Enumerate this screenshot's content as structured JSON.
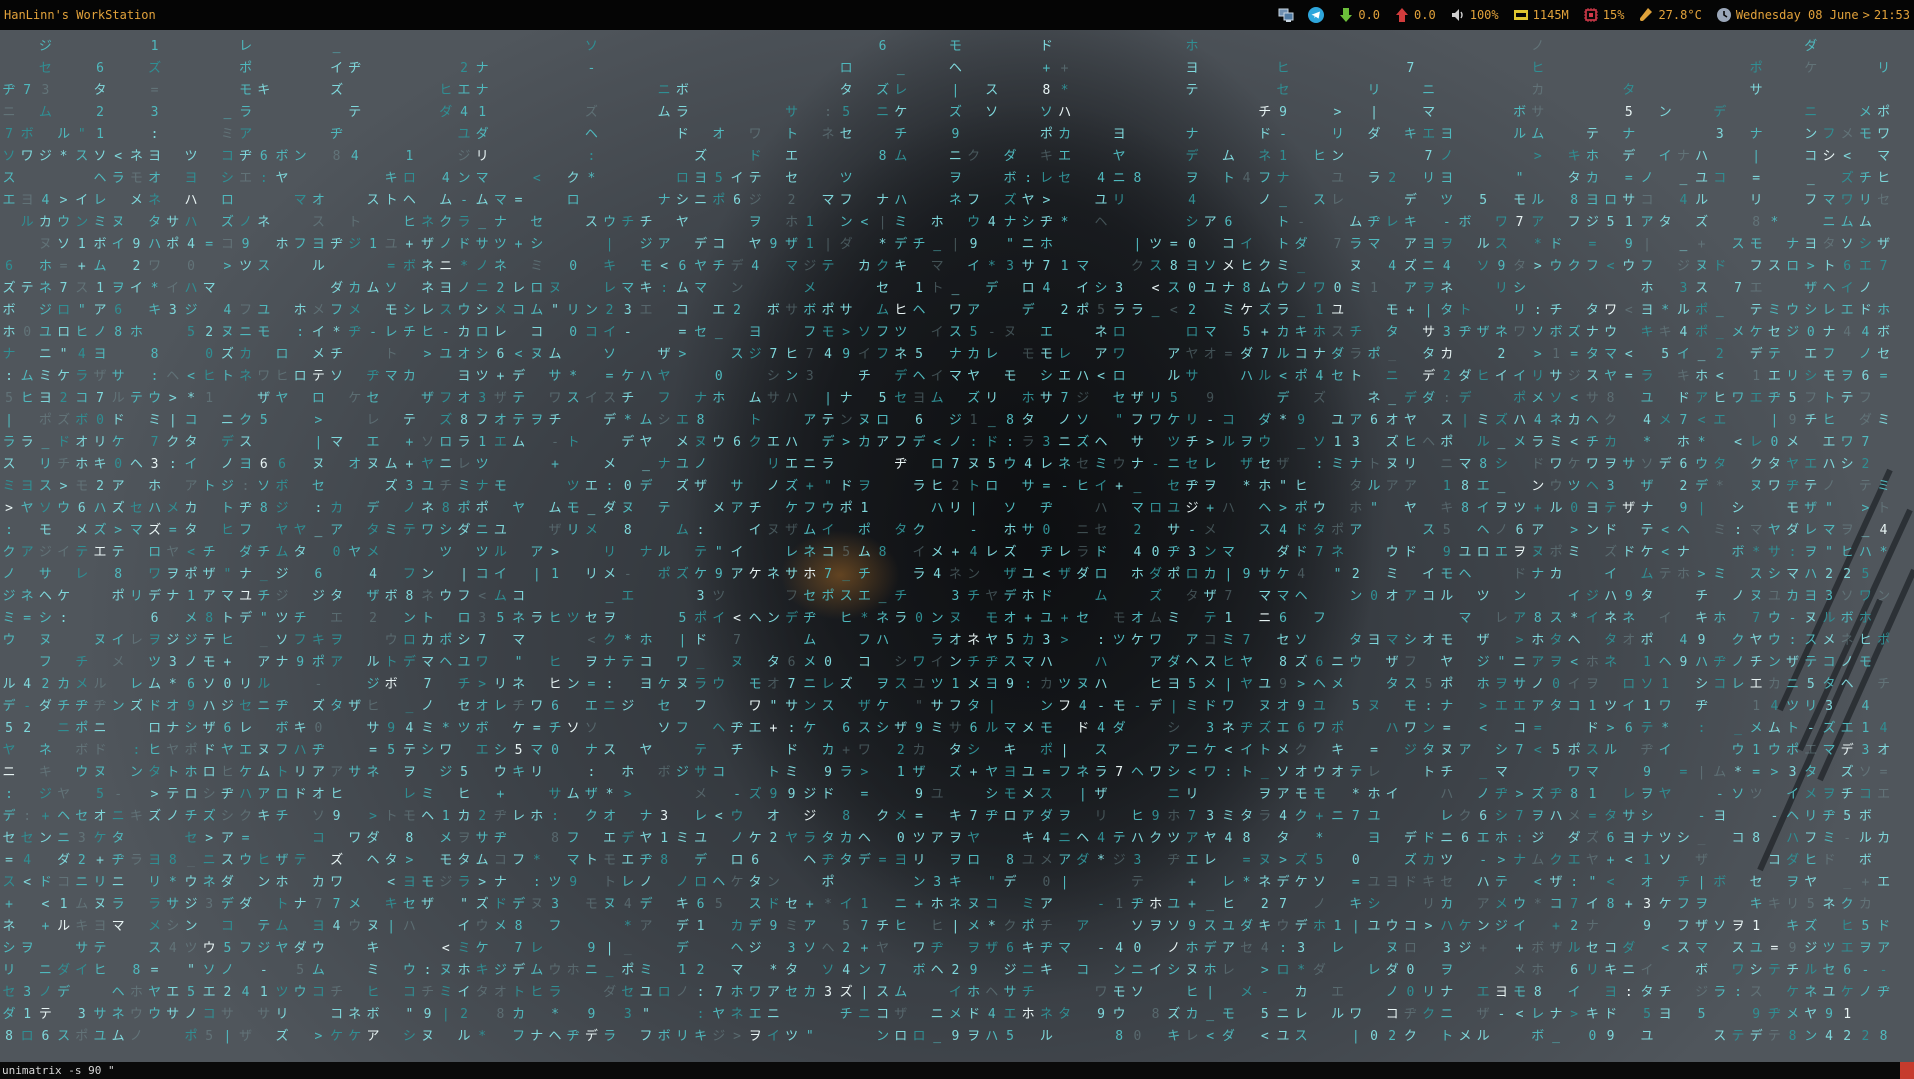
{
  "topbar": {
    "title": "HanLinn's WorkStation",
    "net_down": "0.0",
    "net_up": "0.0",
    "volume": "100%",
    "memory": "1145M",
    "cpu": "15%",
    "temperature": "27.8°C",
    "date": "Wednesday 08 June",
    "separator": ">",
    "time": "21:53"
  },
  "terminal": {
    "command": "unimatrix -s 90 \""
  },
  "matrix": {
    "glyphs": "アイウエオカキクケコサシスセソタチツテトナニヌネノハヒフヘホマミムメモヤユヨラリルレロワヲン0123456789:\"=*+-<>|_ボポザジズダヂデド",
    "seed": 9071
  },
  "colors": {
    "topbar_text": "#e2a23b",
    "topbar_bg": "#050505",
    "matrix_bright": "#7fd8dc",
    "matrix_mid": "#4fb9be",
    "matrix_dim": "#2f8f94",
    "cmdline_bg": "#0a0a0a",
    "cmd_cursor": "#c63b2d"
  },
  "icons": {
    "network": "network-monitor-icon",
    "telegram": "telegram-icon",
    "download": "download-arrow-icon",
    "upload": "upload-arrow-icon",
    "volume": "speaker-icon",
    "memory": "memory-chip-icon",
    "cpu": "cpu-icon",
    "temperature": "thermometer-icon",
    "clock": "clock-icon"
  }
}
